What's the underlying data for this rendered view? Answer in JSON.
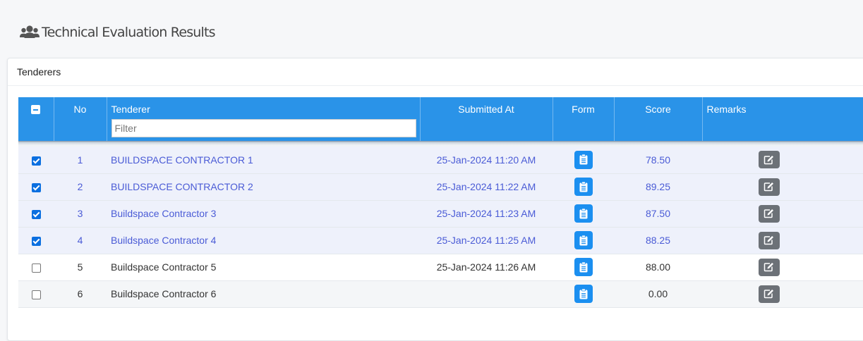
{
  "page": {
    "title": "Technical Evaluation Results",
    "icon": "users-icon"
  },
  "card": {
    "title": "Tenderers"
  },
  "table": {
    "columns": {
      "select": "select-all-checkbox",
      "no": "No",
      "tenderer": "Tenderer",
      "submitted_at": "Submitted At",
      "form": "Form",
      "score": "Score",
      "remarks": "Remarks"
    },
    "filter_placeholder": "Filter",
    "rows": [
      {
        "checked": true,
        "no": "1",
        "tenderer": "BUILDSPACE CONTRACTOR 1",
        "submitted_at": "25-Jan-2024 11:20 AM",
        "score": "78.50"
      },
      {
        "checked": true,
        "no": "2",
        "tenderer": "BUILDSPACE CONTRACTOR 2",
        "submitted_at": "25-Jan-2024 11:22 AM",
        "score": "89.25"
      },
      {
        "checked": true,
        "no": "3",
        "tenderer": "Buildspace Contractor 3",
        "submitted_at": "25-Jan-2024 11:23 AM",
        "score": "87.50"
      },
      {
        "checked": true,
        "no": "4",
        "tenderer": "Buildspace Contractor 4",
        "submitted_at": "25-Jan-2024 11:25 AM",
        "score": "88.25"
      },
      {
        "checked": false,
        "no": "5",
        "tenderer": "Buildspace Contractor 5",
        "submitted_at": "25-Jan-2024 11:26 AM",
        "score": "88.00"
      },
      {
        "checked": false,
        "no": "6",
        "tenderer": "Buildspace Contractor 6",
        "submitted_at": "",
        "score": "0.00"
      }
    ],
    "form_icon": "clipboard-icon",
    "remarks_icon": "edit-icon"
  },
  "colors": {
    "header_bg": "#2a93e8",
    "selected_text": "#4a5bd6",
    "form_button": "#1b8ff0",
    "remarks_button": "#6c7177"
  }
}
